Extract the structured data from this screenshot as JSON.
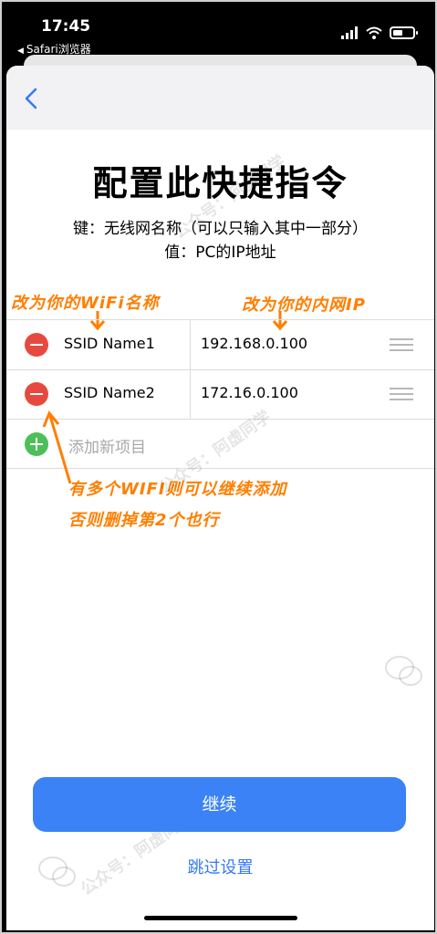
{
  "status_bar": {
    "time": "17:45",
    "back_app": "Safari浏览器",
    "icons": [
      "signal-icon",
      "wifi-icon",
      "battery-icon"
    ]
  },
  "nav": {
    "back_icon": "chevron-left-icon"
  },
  "page": {
    "title": "配置此快捷指令",
    "desc_line1": "键：无线网名称（可以只输入其中一部分）",
    "desc_line2": "值：PC的IP地址"
  },
  "annotations": {
    "left": "改为你的WiFi名称",
    "right": "改为你的内网IP",
    "bottom_line1": "有多个WIFI则可以继续添加",
    "bottom_line2": "否则删掉第2个也行",
    "color": "#ff7f00"
  },
  "rows": [
    {
      "key": "SSID Name1",
      "value": "192.168.0.100"
    },
    {
      "key": "SSID Name2",
      "value": "172.16.0.100"
    }
  ],
  "add_item_label": "添加新项目",
  "buttons": {
    "continue": "继续",
    "skip": "跳过设置"
  },
  "watermark": "公众号：阿虚同学",
  "colors": {
    "accent": "#3b82f6",
    "delete": "#e8493f",
    "add": "#4cbf59",
    "link": "#3478f6"
  }
}
